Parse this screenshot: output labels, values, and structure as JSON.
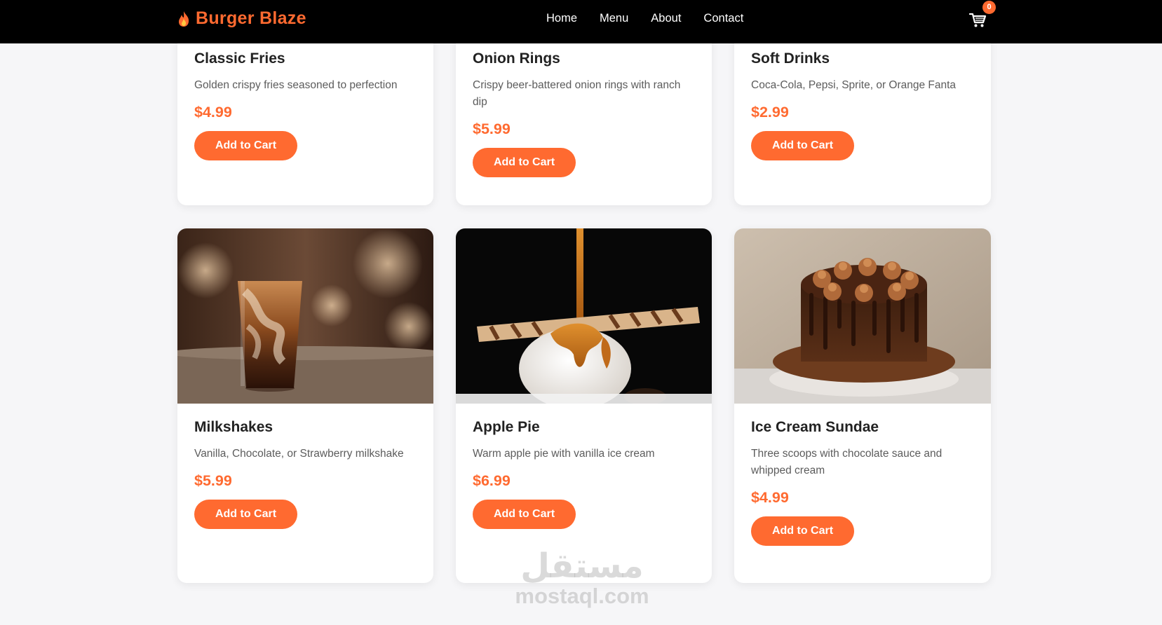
{
  "brand": {
    "name": "Burger Blaze",
    "icon": "flame-icon",
    "color": "#ff6a30"
  },
  "nav": {
    "links": [
      "Home",
      "Menu",
      "About",
      "Contact"
    ],
    "cart_count": "0",
    "cart_icon": "shopping-cart-icon"
  },
  "menu_items": [
    {
      "name": "Classic Fries",
      "description": "Golden crispy fries seasoned to perfection",
      "price": "$4.99",
      "button": "Add to Cart"
    },
    {
      "name": "Onion Rings",
      "description": "Crispy beer-battered onion rings with ranch dip",
      "price": "$5.99",
      "button": "Add to Cart"
    },
    {
      "name": "Soft Drinks",
      "description": "Coca-Cola, Pepsi, Sprite, or Orange Fanta",
      "price": "$2.99",
      "button": "Add to Cart"
    },
    {
      "name": "Milkshakes",
      "description": "Vanilla, Chocolate, or Strawberry milkshake",
      "price": "$5.99",
      "button": "Add to Cart"
    },
    {
      "name": "Apple Pie",
      "description": "Warm apple pie with vanilla ice cream",
      "price": "$6.99",
      "button": "Add to Cart"
    },
    {
      "name": "Ice Cream Sundae",
      "description": "Three scoops with chocolate sauce and whipped cream",
      "price": "$4.99",
      "button": "Add to Cart"
    }
  ],
  "watermark": {
    "arabic": "مستقل",
    "latin": "mostaql.com"
  }
}
